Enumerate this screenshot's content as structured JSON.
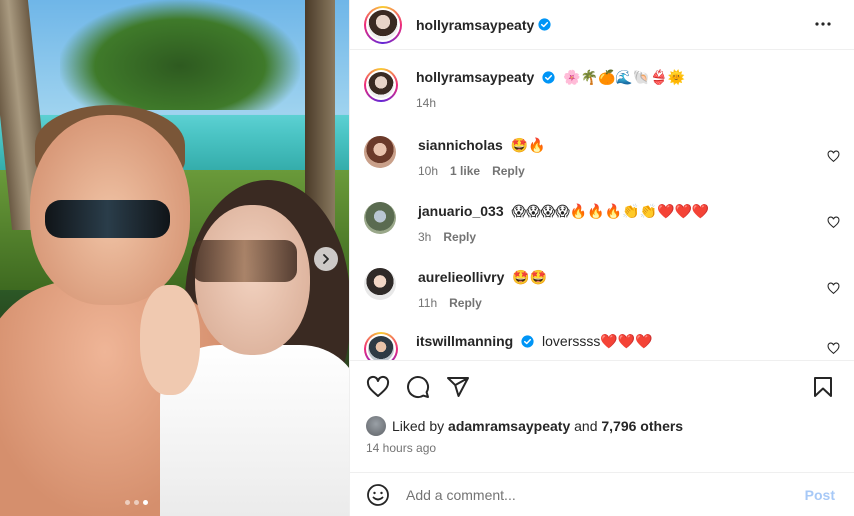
{
  "colors": {
    "accent": "#0095f6",
    "post_disabled": "#a7c9f7",
    "heart_red": "#e0245e",
    "muted": "#737373"
  },
  "photo": {
    "carousel_dots": 3,
    "active_dot": 3,
    "next_icon": "chevron-right-icon"
  },
  "header": {
    "username": "hollyramsaypeaty",
    "verified_icon": "verified-badge-icon",
    "more_icon": "more-horizontal-icon"
  },
  "caption": {
    "username": "hollyramsaypeaty",
    "text": "🌸🌴🍊🌊🐚👙🌞",
    "time": "14h"
  },
  "comments": [
    {
      "username": "siannicholas",
      "text": "🤩🔥",
      "time": "10h",
      "likes": "1 like",
      "reply": "Reply"
    },
    {
      "username": "januario_033",
      "text": "😱😱😱😱🔥🔥🔥👏👏❤️❤️❤️",
      "time": "3h",
      "reply": "Reply"
    },
    {
      "username": "aurelieollivry",
      "text": "🤩🤩",
      "time": "11h",
      "reply": "Reply"
    },
    {
      "username": "itswillmanning",
      "text": "loverssss❤️❤️❤️"
    }
  ],
  "actions": {
    "like_icon": "heart-icon",
    "comment_icon": "comment-icon",
    "share_icon": "share-icon",
    "save_icon": "bookmark-icon"
  },
  "likes": {
    "prefix": "Liked by",
    "user": "adamramsaypeaty",
    "and": "and",
    "others": "7,796 others"
  },
  "time_ago": "14 hours ago",
  "add_comment": {
    "placeholder": "Add a comment...",
    "post_label": "Post",
    "emoji_icon": "smiley-icon"
  }
}
